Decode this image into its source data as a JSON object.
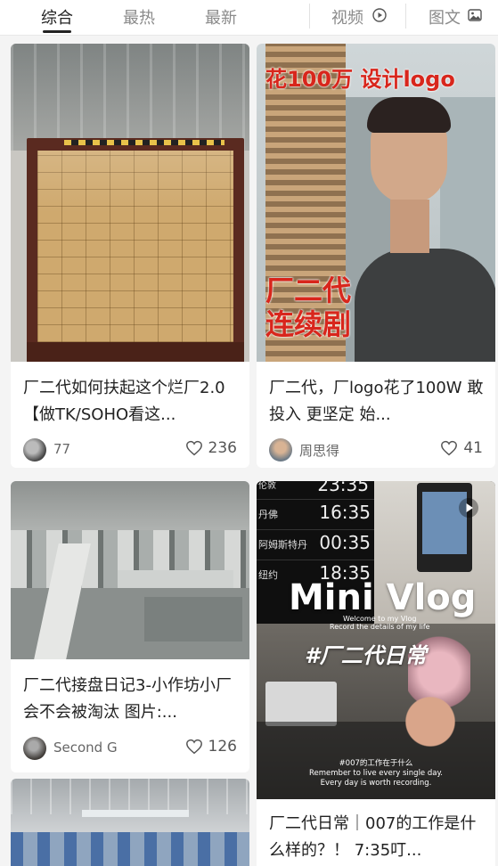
{
  "tabs": {
    "comprehensive": "综合",
    "hottest": "最热",
    "latest": "最新",
    "video": "视频",
    "image_text": "图文"
  },
  "cards": [
    {
      "title": "厂二代如何扶起这个烂厂2.0【做TK/SOHO看这...",
      "author": "77",
      "likes": "236"
    },
    {
      "title": "厂二代，厂logo花了100W 敢投入 更坚定 始...",
      "author": "周思得",
      "likes": "41",
      "overlay_top": "花100万 设计logo",
      "overlay_bottom_1": "厂二代",
      "overlay_bottom_2": "连续剧"
    },
    {
      "title": "厂二代接盘日记3-小作坊小厂会不会被淘汰 图片:...",
      "author": "Second G",
      "likes": "126"
    },
    {
      "title": "厂二代日常｜007的工作是什么样的？！ 7:35叮...",
      "overlay_vlog": "Mini Vlog",
      "overlay_welcome_1": "Welcome to my Vlog",
      "overlay_welcome_2": "Record the details of my life",
      "overlay_hashtag": "#厂二代日常",
      "clock_rows": [
        {
          "city": "伦敦",
          "time": "23:35"
        },
        {
          "city": "丹佛",
          "time": "16:35"
        },
        {
          "city": "阿姆斯特丹",
          "time": "00:35"
        },
        {
          "city": "纽约",
          "time": "18:35"
        }
      ],
      "subtitle_1": "#007的工作在于什么",
      "subtitle_2": "Remember to live every single day.",
      "subtitle_3": "Every day is worth recording."
    }
  ],
  "colors": {
    "accent_red": "#d8261c",
    "text_dark": "#222222",
    "text_muted": "#8a8a8a"
  }
}
